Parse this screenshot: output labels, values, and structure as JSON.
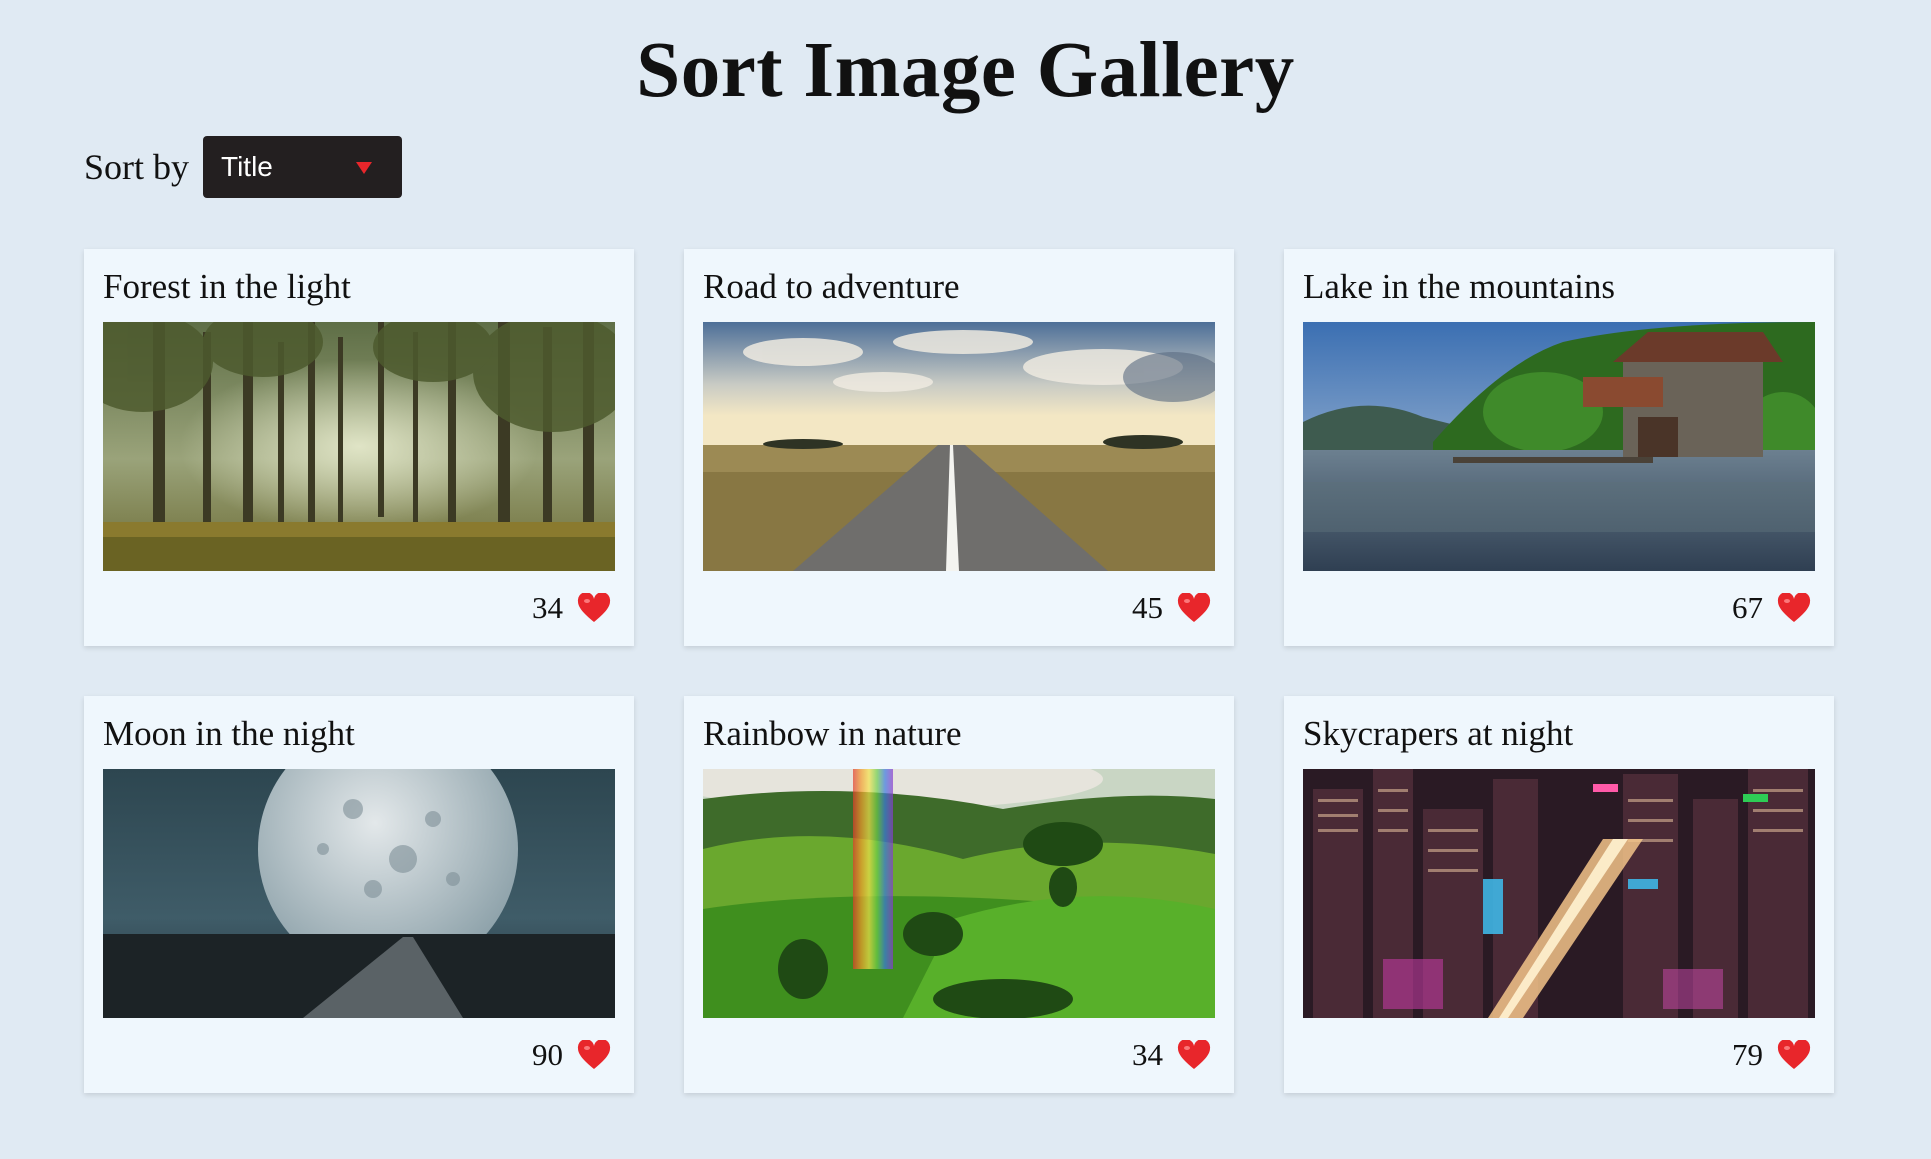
{
  "page": {
    "title": "Sort Image Gallery"
  },
  "sort": {
    "label": "Sort by",
    "selected": "Title"
  },
  "colors": {
    "background": "#e0eaf3",
    "card": "#eff7fd",
    "select": "#231f20",
    "accent": "#e8262b"
  },
  "cards": [
    {
      "title": "Forest in the light",
      "likes": "34",
      "image": "forest"
    },
    {
      "title": "Road to adventure",
      "likes": "45",
      "image": "road"
    },
    {
      "title": "Lake in the mountains",
      "likes": "67",
      "image": "lake"
    },
    {
      "title": "Moon in the night",
      "likes": "90",
      "image": "moon"
    },
    {
      "title": "Rainbow in nature",
      "likes": "34",
      "image": "rainbow"
    },
    {
      "title": "Skycrapers at night",
      "likes": "79",
      "image": "city"
    }
  ]
}
